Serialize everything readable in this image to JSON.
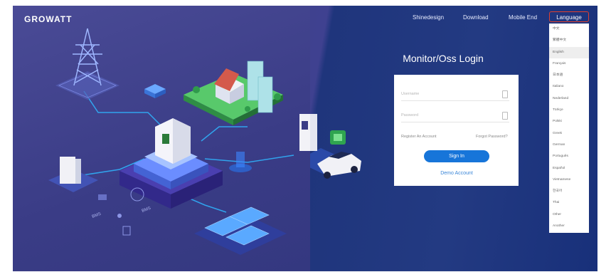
{
  "brand": {
    "logo_text": "GROWATT"
  },
  "nav": {
    "shinedesign": "Shinedesign",
    "download": "Download",
    "mobile_end": "Mobile End",
    "language": "Language"
  },
  "language_menu": {
    "items": [
      "中文",
      "繁體中文",
      "English",
      "Français",
      "日本語",
      "Italiano",
      "Nederland",
      "Türkçe",
      "Polski",
      "Greek",
      "German",
      "Português",
      "Español",
      "Vietnamese",
      "한국어",
      "Thai",
      "Other",
      "Another"
    ],
    "selected": "English"
  },
  "login": {
    "title": "Monitor/Oss Login",
    "username_placeholder": "Username",
    "password_placeholder": "Password",
    "register": "Register An Account",
    "forgot": "Forgot Password?",
    "sign_in": "Sign In",
    "demo": "Demo Account"
  },
  "colors": {
    "background_left": "#3a3c86",
    "background_right": "#1f357c",
    "accent_button": "#1775d9",
    "language_border": "#e0402f"
  }
}
